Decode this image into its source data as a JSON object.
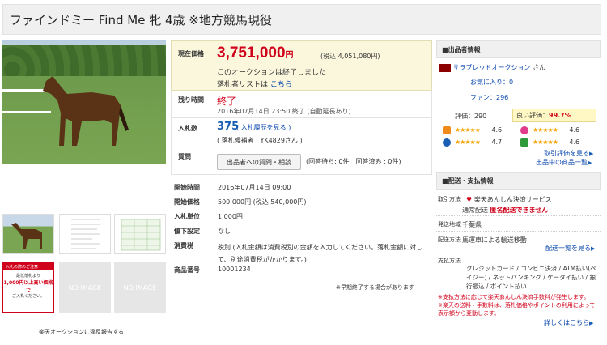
{
  "title": "ファインドミー Find Me 牝 4歳 ※地方競馬現役",
  "price": {
    "label": "現在価格",
    "value": "3,751,000",
    "unit": "円",
    "tax": "(税込 4,051,080円)",
    "ended": "このオークションは終了しました",
    "winner_list": "落札者リストは",
    "winner_link": "こちら"
  },
  "time": {
    "label": "残り時間",
    "status": "終了",
    "date": "2016年07月14日 23:50 終了 (自動延長あり)"
  },
  "bids": {
    "label": "入札数",
    "count": "375",
    "history": "( 入札履歴を見る )",
    "winner": "( 落札候補者 : YK4829さん )"
  },
  "question": {
    "label": "質問",
    "button": "出品者への質問・相談",
    "status": "(回答待ち: 0件　回答済み : 0件)"
  },
  "details": [
    {
      "k": "開始時間",
      "v": "2016年07月14日 09:00"
    },
    {
      "k": "開始価格",
      "v": "500,000円 (税込 540,000円)"
    },
    {
      "k": "入札単位",
      "v": "1,000円"
    },
    {
      "k": "値下設定",
      "v": "なし"
    },
    {
      "k": "消費税",
      "v": "税別 (入札金額は消費税別の金額を入力してください。落札金額に対して、別途消費税がかかります。)"
    },
    {
      "k": "商品番号",
      "v": "10001234"
    }
  ],
  "early_note": "※早期終了する場合があります",
  "report_link": "楽天オークションに違反報告する",
  "noimage": "NO IMAGE",
  "banner_text": [
    "入札の際のご注意",
    "最低落札より",
    "1,000円以上高い価格で",
    "ご入札ください。"
  ],
  "seller": {
    "header": "出品者情報",
    "name": "サラブレッドオークション",
    "suffix": "さん",
    "fav": "お気に入り：0",
    "fans": "ファン：296",
    "rating_label": "評価：",
    "rating": "290",
    "good_label": "良い評価：",
    "good": "99.7%",
    "scores": [
      "4.6",
      "4.6",
      "4.7",
      "4.6"
    ],
    "eval_link": "取引評価を見る",
    "items_link": "出品中の商品一覧"
  },
  "shipping": {
    "header": "配送・支払情報",
    "method_label": "取引方法",
    "method": "楽天あんしん決済サービス",
    "normal": "通常配送",
    "anon": "匿名配送できません",
    "area_label": "発送地域",
    "area": "千葉県",
    "ship_label": "配送方法",
    "ship": "馬運車による輸送移動",
    "ship_link": "配送一覧を見る",
    "pay_label": "支払方法",
    "pay": "クレジットカード / コンビニ決済 / ATM払い(ペイジー) / ネットバンキング / ケータイ払い / 銀行振込 / ポイント払い",
    "note1": "※支払方法に応じて楽天あんしん決済手数料が発生します。",
    "note2": "※楽天の送料・手数料は、落札価格やポイントの利用によって表示額から変動します。",
    "more_link": "詳しくはこちら"
  },
  "colors": {
    "price": "#d0021b",
    "link": "#1a5fb4"
  }
}
